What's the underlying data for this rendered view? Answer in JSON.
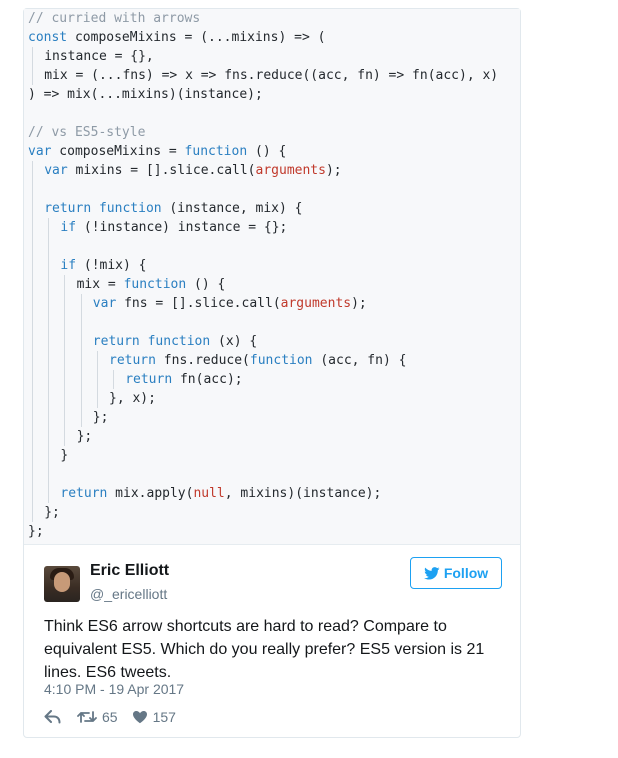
{
  "code_lines": [
    {
      "indent": 0,
      "guides": 0,
      "text": "// curried with arrows",
      "color": "#8e9aa6"
    },
    {
      "indent": 0,
      "guides": 0,
      "text": "const composeMixins = (...mixins) => (",
      "color": "#24292e"
    },
    {
      "indent": 1,
      "guides": 1,
      "text": "instance = {},",
      "color": "#24292e"
    },
    {
      "indent": 1,
      "guides": 1,
      "text": "mix = (...fns) => x => fns.reduce((acc, fn) => fn(acc), x)",
      "color": "#24292e"
    },
    {
      "indent": 0,
      "guides": 0,
      "text": ") => mix(...mixins)(instance);",
      "color": "#24292e"
    },
    {
      "indent": 0,
      "guides": 0,
      "text": "",
      "color": "#24292e"
    },
    {
      "indent": 0,
      "guides": 0,
      "text": "// vs ES5-style",
      "color": "#8e9aa6"
    },
    {
      "indent": 0,
      "guides": 0,
      "text": "var composeMixins = function () {",
      "color": "#24292e"
    },
    {
      "indent": 1,
      "guides": 1,
      "text": "var mixins = [].slice.call(arguments);",
      "color": "#24292e"
    },
    {
      "indent": 0,
      "guides": 1,
      "text": "",
      "color": "#24292e"
    },
    {
      "indent": 1,
      "guides": 1,
      "text": "return function (instance, mix) {",
      "color": "#24292e"
    },
    {
      "indent": 2,
      "guides": 2,
      "text": "if (!instance) instance = {};",
      "color": "#24292e"
    },
    {
      "indent": 0,
      "guides": 2,
      "text": "",
      "color": "#24292e"
    },
    {
      "indent": 2,
      "guides": 2,
      "text": "if (!mix) {",
      "color": "#24292e"
    },
    {
      "indent": 3,
      "guides": 3,
      "text": "mix = function () {",
      "color": "#24292e"
    },
    {
      "indent": 4,
      "guides": 4,
      "text": "var fns = [].slice.call(arguments);",
      "color": "#24292e"
    },
    {
      "indent": 0,
      "guides": 4,
      "text": "",
      "color": "#24292e"
    },
    {
      "indent": 4,
      "guides": 4,
      "text": "return function (x) {",
      "color": "#24292e"
    },
    {
      "indent": 5,
      "guides": 5,
      "text": "return fns.reduce(function (acc, fn) {",
      "color": "#24292e"
    },
    {
      "indent": 6,
      "guides": 6,
      "text": "return fn(acc);",
      "color": "#24292e"
    },
    {
      "indent": 5,
      "guides": 5,
      "text": "}, x);",
      "color": "#24292e"
    },
    {
      "indent": 4,
      "guides": 4,
      "text": "};",
      "color": "#24292e"
    },
    {
      "indent": 3,
      "guides": 3,
      "text": "};",
      "color": "#24292e"
    },
    {
      "indent": 2,
      "guides": 2,
      "text": "}",
      "color": "#24292e"
    },
    {
      "indent": 0,
      "guides": 2,
      "text": "",
      "color": "#24292e"
    },
    {
      "indent": 2,
      "guides": 2,
      "text": "return mix.apply(null, mixins)(instance);",
      "color": "#24292e"
    },
    {
      "indent": 1,
      "guides": 1,
      "text": "};",
      "color": "#24292e"
    },
    {
      "indent": 0,
      "guides": 0,
      "text": "};",
      "color": "#24292e"
    }
  ],
  "tweet": {
    "name": "Eric Elliott",
    "handle": "@_ericelliott",
    "follow_label": "Follow",
    "text": "Think ES6 arrow shortcuts are hard to read? Compare to equivalent ES5. Which do you really prefer? ES5 version is 21 lines. ES6 tweets.",
    "timestamp": "4:10 PM - 19 Apr 2017",
    "retweets": "65",
    "likes": "157",
    "icons": {
      "reply": "reply-icon",
      "retweet": "retweet-icon",
      "like": "heart-icon",
      "follow": "twitter-bird-icon"
    }
  },
  "colors": {
    "accent": "#1da1f2",
    "meta": "#657786",
    "code_keyword": "#2a7fc1",
    "code_builtin": "#c0392b",
    "code_comment": "#8e9aa6"
  }
}
